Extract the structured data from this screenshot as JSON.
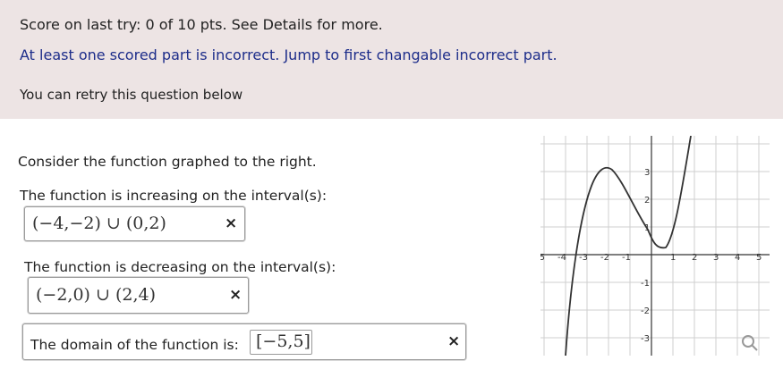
{
  "feedback": {
    "score_line": "Score on last try: 0 of 10 pts. See Details for more.",
    "incorrect_line": "At least one scored part is incorrect. Jump to first changable incorrect part.",
    "retry_line": "You can retry this question below"
  },
  "question": {
    "prompt": "Consider the function graphed to the right.",
    "increasing_label": "The function is increasing on the interval(s):",
    "increasing_answer": "(−4,−2) ∪ (0,2)",
    "decreasing_label": "The function is decreasing on the interval(s):",
    "decreasing_answer": "(−2,0) ∪ (2,4)",
    "domain_label": "The domain of the function is:",
    "domain_answer": "[−5,5]",
    "incorrect_mark": "×"
  },
  "graph": {
    "x_tick_labels": [
      "-5",
      "-4",
      "-3",
      "-2",
      "-1",
      "1",
      "2",
      "3",
      "4",
      "5"
    ],
    "y_tick_labels": [
      "3",
      "2",
      "1",
      "-1",
      "-2",
      "-3"
    ],
    "icons": [
      "search-icon"
    ]
  }
}
